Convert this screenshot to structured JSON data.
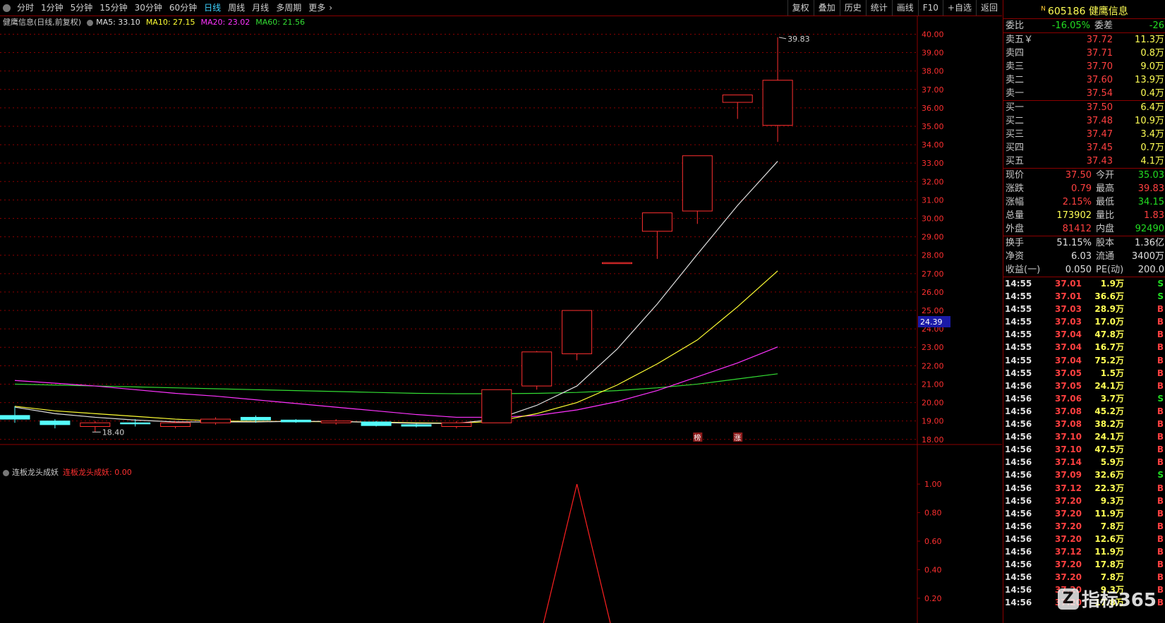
{
  "toolbar": {
    "tabs": [
      "分时",
      "1分钟",
      "5分钟",
      "15分钟",
      "30分钟",
      "60分钟",
      "日线",
      "周线",
      "月线",
      "多周期",
      "更多"
    ],
    "active_tab": "日线",
    "right_buttons": [
      "复权",
      "叠加",
      "历史",
      "统计",
      "画线",
      "F10",
      "+自选",
      "返回"
    ]
  },
  "legend": {
    "title": "健鹰信息(日线,前复权)",
    "ma5": "MA5: 33.10",
    "ma10": "MA10: 27.15",
    "ma20": "MA20: 23.02",
    "ma60": "MA60: 21.56",
    "indicator_name": "连板龙头成妖",
    "indicator_value": "连板龙头成妖: 0.00"
  },
  "colors": {
    "up": "#ff3030",
    "down": "#54fcfc",
    "ma5": "#e0e0e0",
    "ma10": "#ffff33",
    "ma20": "#ff33ff",
    "ma60": "#33dd33",
    "axis": "#8b0000"
  },
  "chart_data": {
    "type": "candlestick",
    "price_axis_ticks": [
      "40.00",
      "39.00",
      "38.00",
      "37.00",
      "36.00",
      "35.00",
      "34.00",
      "33.00",
      "32.00",
      "31.00",
      "30.00",
      "29.00",
      "28.00",
      "27.00",
      "26.00",
      "25.00",
      "24.00",
      "23.00",
      "22.00",
      "21.00",
      "20.00",
      "19.00",
      "18.00"
    ],
    "ylim": [
      17.8,
      40.4
    ],
    "current_price_label": "24.39",
    "current_price": 24.39,
    "high_annotation": "39.83",
    "low_annotation": "18.40",
    "candles": [
      {
        "o": 19.3,
        "h": 19.8,
        "l": 18.9,
        "c": 19.1
      },
      {
        "o": 19.0,
        "h": 19.1,
        "l": 18.6,
        "c": 18.8
      },
      {
        "o": 18.7,
        "h": 19.0,
        "l": 18.4,
        "c": 18.9
      },
      {
        "o": 18.9,
        "h": 19.1,
        "l": 18.7,
        "c": 18.85
      },
      {
        "o": 18.7,
        "h": 19.0,
        "l": 18.6,
        "c": 18.9
      },
      {
        "o": 18.9,
        "h": 19.2,
        "l": 18.8,
        "c": 19.1
      },
      {
        "o": 19.2,
        "h": 19.3,
        "l": 18.9,
        "c": 19.05
      },
      {
        "o": 19.05,
        "h": 19.1,
        "l": 18.9,
        "c": 18.95
      },
      {
        "o": 18.9,
        "h": 19.1,
        "l": 18.8,
        "c": 19.0
      },
      {
        "o": 18.95,
        "h": 19.0,
        "l": 18.7,
        "c": 18.75
      },
      {
        "o": 18.8,
        "h": 18.85,
        "l": 18.65,
        "c": 18.72
      },
      {
        "o": 18.7,
        "h": 19.0,
        "l": 18.6,
        "c": 18.9
      },
      {
        "o": 18.9,
        "h": 20.7,
        "l": 18.9,
        "c": 20.7
      },
      {
        "o": 20.9,
        "h": 22.8,
        "l": 20.7,
        "c": 22.75
      },
      {
        "o": 22.65,
        "h": 25.0,
        "l": 22.3,
        "c": 25.0
      },
      {
        "o": 27.6,
        "h": 27.6,
        "l": 27.6,
        "c": 27.6
      },
      {
        "o": 29.3,
        "h": 30.3,
        "l": 27.8,
        "c": 30.3
      },
      {
        "o": 30.4,
        "h": 33.4,
        "l": 29.7,
        "c": 33.4
      },
      {
        "o": 36.3,
        "h": 36.7,
        "l": 35.4,
        "c": 36.7
      },
      {
        "o": 35.05,
        "h": 39.83,
        "l": 34.15,
        "c": 37.5
      }
    ],
    "ma5": [
      19.75,
      19.4,
      19.2,
      19.05,
      18.95,
      18.95,
      18.95,
      18.98,
      18.98,
      18.92,
      18.87,
      18.87,
      19.1,
      19.85,
      20.9,
      22.9,
      25.35,
      28.05,
      30.7,
      33.1
    ],
    "ma10": [
      19.8,
      19.55,
      19.4,
      19.25,
      19.1,
      19.0,
      18.98,
      18.97,
      18.96,
      18.94,
      18.9,
      18.88,
      18.98,
      19.4,
      20.0,
      20.95,
      22.1,
      23.4,
      25.2,
      27.15
    ],
    "ma20": [
      21.2,
      21.05,
      20.9,
      20.7,
      20.5,
      20.35,
      20.15,
      19.95,
      19.75,
      19.55,
      19.35,
      19.2,
      19.2,
      19.3,
      19.6,
      20.05,
      20.65,
      21.4,
      22.15,
      23.02
    ],
    "ma60": [
      21.0,
      20.95,
      20.9,
      20.85,
      20.8,
      20.75,
      20.7,
      20.65,
      20.6,
      20.55,
      20.5,
      20.48,
      20.48,
      20.5,
      20.55,
      20.65,
      20.8,
      21.0,
      21.28,
      21.56
    ],
    "markers": [
      "榜",
      "涨"
    ],
    "indicator": {
      "name": "连板龙头成妖",
      "axis_ticks": [
        "1.00",
        "0.80",
        "0.60",
        "0.40",
        "0.20"
      ],
      "ylim": [
        0.15,
        1.05
      ],
      "values": [
        0,
        0,
        0,
        0,
        0,
        0,
        0,
        0,
        0,
        0,
        0,
        0,
        0,
        0,
        1,
        0,
        0,
        0,
        0,
        0
      ]
    }
  },
  "panel": {
    "stock_code": "605186",
    "stock_name": "健鹰信息",
    "badge": "N",
    "weibi_label": "委比",
    "weibi_value": "-16.05%",
    "weicha_label": "委差",
    "weicha_value": "-26",
    "asks": [
      {
        "label": "卖五￥",
        "price": "37.72",
        "vol": "11.3万"
      },
      {
        "label": "卖四",
        "price": "37.71",
        "vol": "0.8万"
      },
      {
        "label": "卖三",
        "price": "37.70",
        "vol": "9.0万"
      },
      {
        "label": "卖二",
        "price": "37.60",
        "vol": "13.9万"
      },
      {
        "label": "卖一",
        "price": "37.54",
        "vol": "0.4万"
      }
    ],
    "bids": [
      {
        "label": "买一",
        "price": "37.50",
        "vol": "6.4万"
      },
      {
        "label": "买二",
        "price": "37.48",
        "vol": "10.9万"
      },
      {
        "label": "买三",
        "price": "37.47",
        "vol": "3.4万"
      },
      {
        "label": "买四",
        "price": "37.45",
        "vol": "0.7万"
      },
      {
        "label": "买五",
        "price": "37.43",
        "vol": "4.1万"
      }
    ],
    "quote": [
      {
        "l1": "现价",
        "v1": "37.50",
        "c1": "red",
        "l2": "今开",
        "v2": "35.03",
        "c2": "green"
      },
      {
        "l1": "涨跌",
        "v1": "0.79",
        "c1": "red",
        "l2": "最高",
        "v2": "39.83",
        "c2": "red"
      },
      {
        "l1": "涨幅",
        "v1": "2.15%",
        "c1": "red",
        "l2": "最低",
        "v2": "34.15",
        "c2": "green"
      },
      {
        "l1": "总量",
        "v1": "173902",
        "c1": "yellow",
        "l2": "量比",
        "v2": "1.83",
        "c2": "red"
      },
      {
        "l1": "外盘",
        "v1": "81412",
        "c1": "red",
        "l2": "内盘",
        "v2": "92490",
        "c2": "green"
      }
    ],
    "fund": [
      {
        "l1": "换手",
        "v1": "51.15%",
        "l2": "股本",
        "v2": "1.36亿"
      },
      {
        "l1": "净资",
        "v1": "6.03",
        "l2": "流通",
        "v2": "3400万"
      },
      {
        "l1": "收益(一)",
        "v1": "0.050",
        "l2": "PE(动)",
        "v2": "200.0"
      }
    ],
    "ticks": [
      {
        "t": "14:55",
        "p": "37.01",
        "v": "1.9万",
        "d": "S"
      },
      {
        "t": "14:55",
        "p": "37.01",
        "v": "36.6万",
        "d": "S"
      },
      {
        "t": "14:55",
        "p": "37.03",
        "v": "28.9万",
        "d": "B"
      },
      {
        "t": "14:55",
        "p": "37.03",
        "v": "17.0万",
        "d": "B"
      },
      {
        "t": "14:55",
        "p": "37.04",
        "v": "47.8万",
        "d": "B"
      },
      {
        "t": "14:55",
        "p": "37.04",
        "v": "16.7万",
        "d": "B"
      },
      {
        "t": "14:55",
        "p": "37.04",
        "v": "75.2万",
        "d": "B"
      },
      {
        "t": "14:55",
        "p": "37.05",
        "v": "1.5万",
        "d": "B"
      },
      {
        "t": "14:56",
        "p": "37.05",
        "v": "24.1万",
        "d": "B"
      },
      {
        "t": "14:56",
        "p": "37.06",
        "v": "3.7万",
        "d": "S"
      },
      {
        "t": "14:56",
        "p": "37.08",
        "v": "45.2万",
        "d": "B"
      },
      {
        "t": "14:56",
        "p": "37.08",
        "v": "38.2万",
        "d": "B"
      },
      {
        "t": "14:56",
        "p": "37.10",
        "v": "24.1万",
        "d": "B"
      },
      {
        "t": "14:56",
        "p": "37.10",
        "v": "47.5万",
        "d": "B"
      },
      {
        "t": "14:56",
        "p": "37.14",
        "v": "5.9万",
        "d": "B"
      },
      {
        "t": "14:56",
        "p": "37.09",
        "v": "32.6万",
        "d": "S"
      },
      {
        "t": "14:56",
        "p": "37.12",
        "v": "22.3万",
        "d": "B"
      },
      {
        "t": "14:56",
        "p": "37.20",
        "v": "9.3万",
        "d": "B"
      },
      {
        "t": "14:56",
        "p": "37.20",
        "v": "11.9万",
        "d": "B"
      },
      {
        "t": "14:56",
        "p": "37.20",
        "v": "7.8万",
        "d": "B"
      },
      {
        "t": "14:56",
        "p": "37.20",
        "v": "12.6万",
        "d": "B"
      },
      {
        "t": "14:56",
        "p": "37.12",
        "v": "11.9万",
        "d": "B"
      },
      {
        "t": "14:56",
        "p": "37.20",
        "v": "17.8万",
        "d": "B"
      },
      {
        "t": "14:56",
        "p": "37.20",
        "v": "7.8万",
        "d": "B"
      },
      {
        "t": "14:56",
        "p": "37.20",
        "v": "9.3万",
        "d": "B"
      },
      {
        "t": "14:56",
        "p": "37.20",
        "v": "17.8万",
        "d": "B"
      }
    ]
  },
  "watermark": {
    "logo": "Z",
    "text": "指标365"
  }
}
